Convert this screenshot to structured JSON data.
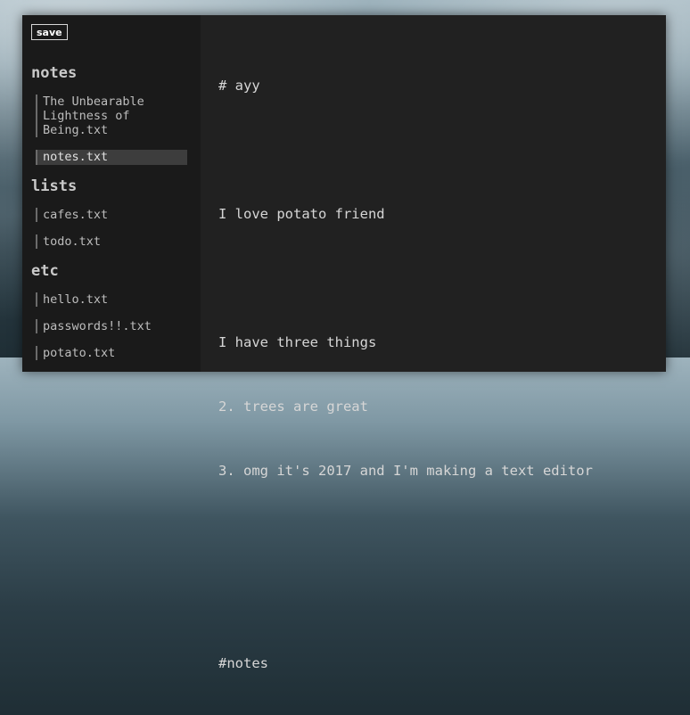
{
  "toolbar": {
    "save_label": "save"
  },
  "sidebar": {
    "sections": [
      {
        "title": "notes",
        "files": [
          "The Unbearable Lightness of Being.txt",
          "notes.txt"
        ]
      },
      {
        "title": "lists",
        "files": [
          "cafes.txt",
          "todo.txt"
        ]
      },
      {
        "title": "etc",
        "files": [
          "hello.txt",
          "passwords!!.txt",
          "potato.txt"
        ]
      }
    ],
    "active_file": "notes.txt"
  },
  "editor": {
    "lines": [
      "# ayy",
      "",
      "I love potato friend",
      "",
      "I have three things",
      "2. trees are great",
      "3. omg it's 2017 and I'm making a text editor",
      "",
      "",
      "#notes"
    ]
  }
}
